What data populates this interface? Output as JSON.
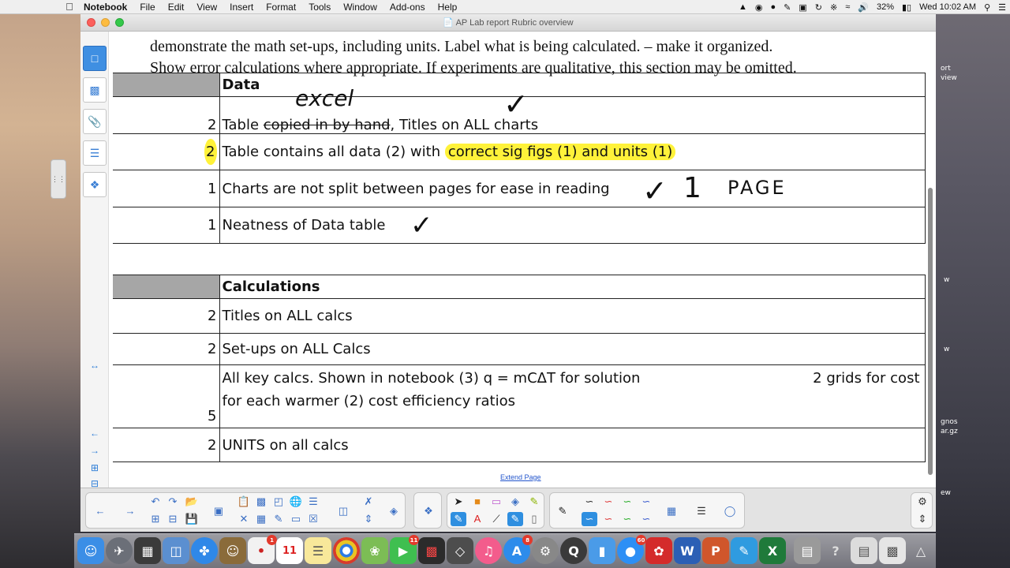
{
  "menubar": {
    "app_name": "Notebook",
    "items": [
      "File",
      "Edit",
      "View",
      "Insert",
      "Format",
      "Tools",
      "Window",
      "Add-ons",
      "Help"
    ],
    "battery": "32%",
    "clock": "Wed 10:02 AM"
  },
  "window": {
    "title": "AP Lab report Rubric overview"
  },
  "document": {
    "line1": "demonstrate the math set-ups, including units.  Label what is being calculated. – make it organized.",
    "line2": "Show error calculations where appropriate. If experiments are qualitative, this section may be omitted."
  },
  "data_table": {
    "header": "Data",
    "rows": [
      {
        "points": "2",
        "strike_text": "copied in by hand",
        "prefix": "Table ",
        "suffix": ", Titles on ALL charts"
      },
      {
        "points": "2",
        "text_plain": "Table contains all data (2) with ",
        "text_highlight": "correct sig figs (1) and units (1)"
      },
      {
        "points": "1",
        "text": "Charts are not split between pages for ease in reading"
      },
      {
        "points": "1",
        "text": "Neatness of Data table"
      }
    ]
  },
  "calc_table": {
    "header": "Calculations",
    "rows": [
      {
        "points": "2",
        "text": "Titles on ALL calcs"
      },
      {
        "points": "2",
        "text": "Set-ups on ALL Calcs"
      },
      {
        "points": "5",
        "line1": "All key calcs. Shown in notebook  (3) q = mCΔT for solution",
        "line1_right": "2 grids for cost",
        "line2": "for each warmer    (2) cost efficiency ratios"
      },
      {
        "points": "2",
        "text": "UNITS on all calcs"
      }
    ]
  },
  "handwriting": {
    "excel": "excel",
    "check": "✓",
    "one": "1",
    "page": "PAGE"
  },
  "extend_page": "Extend Page",
  "desktop_labels": [
    "ort",
    "view",
    "w",
    "w",
    "gnos",
    "ar.gz",
    "ew"
  ],
  "dock_badges": [
    "1",
    "11",
    "8",
    "60"
  ],
  "colors": {
    "highlight": "#fff23a",
    "header_gray": "#a6a6a6",
    "accent": "#3f8fe2"
  }
}
